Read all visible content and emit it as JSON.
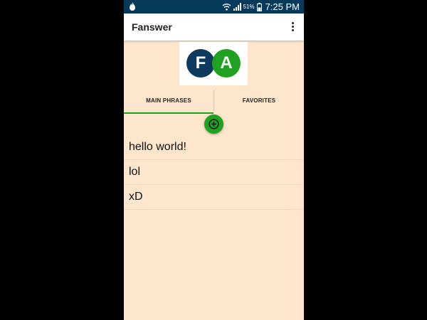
{
  "status_bar": {
    "battery_percent": "51%",
    "time": "7:25 PM",
    "icons": [
      "flame-icon",
      "wifi-icon",
      "signal-icon",
      "battery-icon"
    ]
  },
  "app_bar": {
    "title": "Fanswer",
    "menu_icon": "overflow-menu-icon"
  },
  "logo": {
    "letters": [
      "F",
      "A"
    ],
    "colors": [
      "#0e3a5e",
      "#1ea21f"
    ]
  },
  "tabs": [
    {
      "label": "MAIN PHRASES",
      "selected": true
    },
    {
      "label": "FAVORITES",
      "selected": false
    }
  ],
  "fab": {
    "icon": "add-circle-icon"
  },
  "phrases": [
    "hello world!",
    "lol",
    "xD"
  ],
  "colors": {
    "status_bar": "#063a5a",
    "background": "#fde6cc",
    "accent": "#1ea21f"
  }
}
